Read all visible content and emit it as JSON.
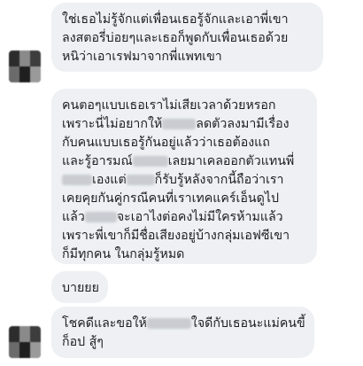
{
  "messages": [
    {
      "lines": [
        "ใช่เธอไม่รู้จักแต่เพื่อนเธอรู้จักและเอาพี่เขา",
        "ลงสตอรี่บ่อยๆและเธอก็พูดกับเพื่อนเธอด้วย",
        "หนิว่าเอาเรฟมาจากพี่แพทเขา"
      ]
    },
    {
      "lines": [
        "คนตอๆแบบเธอเราไม่เสียเวลาด้วยหรอก",
        [
          "เพราะนี่ไม่อยากให้",
          "ลดตัวลงมามีเรื่อง"
        ],
        "กับคนแบบเธอรู้กันอยู่แล้วว่าเธอต้องแถ",
        [
          "และรู้อารมณ์",
          "เลยมาเคลออกตัวแทนพี่"
        ],
        [
          "",
          "เองแต่",
          "ก็รับรู้หลังจากนี้ถือว่าเรา"
        ],
        "เคยคุยกันคู่กรณีคนที่เราเทคแคร์เอ็นดูไป",
        [
          "แล้ว",
          "จะเอาไงต่อคงไม่มีใครห้ามแล้ว"
        ],
        "เพราะพี่เขาก็มีชื่อเสียงอยู่บ้างกลุ่มเอฟซีเขา",
        "ก็มีทุกคน ในกลุ่มรู้หมด"
      ]
    },
    {
      "lines": [
        "บายยย"
      ]
    },
    {
      "lines": [
        [
          "โชคดีและขอให้",
          "ใจดีกับเธอนะแม่คนขี้"
        ],
        "ก็อป สู้ๆ"
      ]
    }
  ]
}
